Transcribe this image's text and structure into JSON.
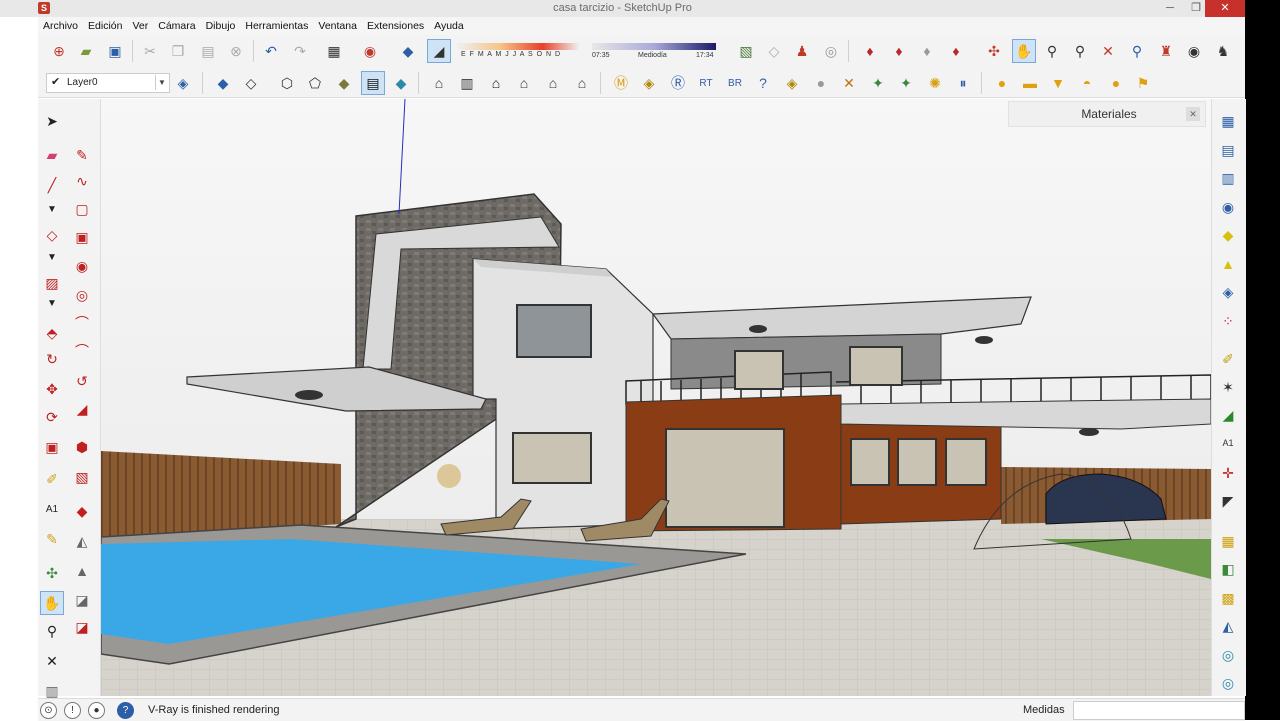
{
  "window": {
    "title": "casa tarcizio - SketchUp Pro",
    "app_icon_letter": "S"
  },
  "menu": [
    "Archivo",
    "Edición",
    "Ver",
    "Cámara",
    "Dibujo",
    "Herramientas",
    "Ventana",
    "Extensiones",
    "Ayuda"
  ],
  "shadow": {
    "months": "E F M A M J J A S O N D",
    "time_start": "07:35",
    "time_mid": "Mediodía",
    "time_end": "17:34"
  },
  "layer": {
    "current": "Layer0"
  },
  "materials_tray": {
    "title": "Materiales"
  },
  "status": {
    "message": "V-Ray is finished rendering",
    "measure_label": "Medidas",
    "measure_value": ""
  },
  "colors": {
    "pool": "#3aa7e6",
    "wall_brown": "#8a3d14",
    "stone": "#6e6a66",
    "deck": "#bfb7ae"
  },
  "icons": {
    "toolbar1": [
      "new-file-icon",
      "open-icon",
      "save-icon",
      "cut-icon",
      "copy-icon",
      "paste-icon",
      "erase-icon",
      "undo-icon",
      "redo-icon",
      "print-icon",
      "model-info-icon",
      "component-icon",
      "eraser-icon"
    ],
    "toolbar1_right": [
      "map-icon",
      "photo-texture-icon",
      "figure-icon",
      "3d-warehouse-icon",
      "ruby-icon",
      "gem-icon",
      "extension-icon",
      "gem2-icon",
      "orbit-icon",
      "pan-icon",
      "zoom-icon",
      "zoom-window-icon",
      "zoom-extents-icon",
      "previous-view-icon",
      "position-camera-icon",
      "look-around-icon",
      "walk-icon"
    ],
    "toolbar2_views": [
      "iso-view-icon",
      "top-view-icon",
      "front-view-icon",
      "right-view-icon",
      "back-view-icon",
      "left-view-icon",
      "xray-icon",
      "wireframe-icon"
    ],
    "toolbar2_styles": [
      "hidden-line-icon",
      "shaded-icon",
      "textured-icon",
      "monochrome-icon",
      "house-icon",
      "house-front-icon",
      "house-outline-icon",
      "house-side-icon"
    ],
    "toolbar2_vray": [
      "vray-material-icon",
      "vray-options-icon",
      "vray-render-icon",
      "vray-rt-icon",
      "vray-batch-icon",
      "vray-help-icon",
      "vray-light-icon",
      "vray-sphere-icon",
      "vray-mesh-icon",
      "vray-proxy-icon",
      "vray-grass-icon",
      "vray-sun-icon",
      "vray-pause-icon"
    ],
    "toolbar2_lights": [
      "omni-light-icon",
      "rect-light-icon",
      "spot-light-icon",
      "dome-light-icon",
      "sphere-light-icon",
      "ies-light-icon"
    ],
    "left": [
      "select-icon",
      "eraser-icon",
      "pencil-icon",
      "line-icon",
      "freehand-icon",
      "rectangle-icon",
      "rotated-rect-icon",
      "circle-icon",
      "polygon-icon",
      "arc-icon",
      "two-point-arc-icon",
      "pie-icon",
      "push-pull-icon",
      "follow-me-icon",
      "move-icon",
      "rotate-icon",
      "scale-icon",
      "offset-icon",
      "tape-icon",
      "dimension-icon",
      "protractor-icon",
      "text-icon",
      "axes-icon",
      "3d-text-icon",
      "paint-icon",
      "orbit-icon",
      "pan-icon",
      "zoom-icon",
      "zoom-extents-icon",
      "section-icon"
    ],
    "right": [
      "layers-icon",
      "outliner-icon",
      "components-icon",
      "entity-info-icon",
      "scenes-icon",
      "styles-icon",
      "materials-icon",
      "soften-icon",
      "tape-icon",
      "dimension-icon",
      "protractor-icon",
      "text-icon",
      "axes-icon",
      "section-plane-icon",
      "sandbox-icon",
      "drape-icon",
      "stamp-icon",
      "smoove-icon",
      "flip-icon",
      "add-detail-icon",
      "terrain-icon"
    ]
  }
}
